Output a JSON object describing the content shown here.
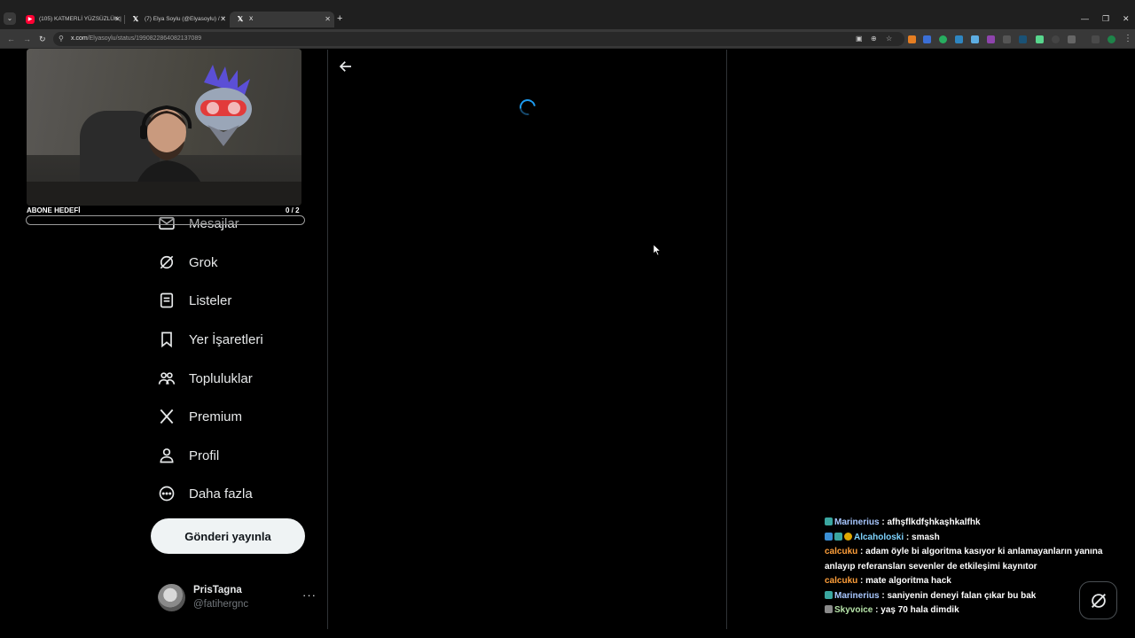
{
  "browser": {
    "tabs": [
      {
        "title": "(105) KATMERLİ YÜZSÜZLÜK |",
        "icon": "youtube-icon"
      },
      {
        "title": "(7) Elya Soylu (@Elyasoylu) / X",
        "icon": "x-logo-icon"
      },
      {
        "title": "X",
        "icon": "x-logo-icon"
      }
    ],
    "url_host": "x.com",
    "url_path": "/Elyasoylu/status/1990822864082137089"
  },
  "sidebar": {
    "items": [
      {
        "label": "Mesajlar",
        "icon": "mail-icon"
      },
      {
        "label": "Grok",
        "icon": "grok-icon"
      },
      {
        "label": "Listeler",
        "icon": "list-icon"
      },
      {
        "label": "Yer İşaretleri",
        "icon": "bookmark-icon"
      },
      {
        "label": "Topluluklar",
        "icon": "communities-icon"
      },
      {
        "label": "Premium",
        "icon": "x-logo-icon"
      },
      {
        "label": "Profil",
        "icon": "person-icon"
      },
      {
        "label": "Daha fazla",
        "icon": "more-circle-icon"
      }
    ],
    "post_button": "Gönderi yayınla",
    "profile": {
      "name": "PrisTagna",
      "handle": "@fatihergnc",
      "more": "···"
    }
  },
  "stream": {
    "sub_goal_label": "ABONE HEDEFİ",
    "sub_goal_count": "0  / 2",
    "sub_goal_progress": 0
  },
  "chat": {
    "messages": [
      {
        "user": "Marinerius",
        "color": "#a8c7ff",
        "text": "afhşflkdfşhkaşhkalfhk"
      },
      {
        "user": "Alcaholoski",
        "color": "#7fd4ff",
        "text": "smash"
      },
      {
        "user": "calcuku",
        "color": "#ff9f3a",
        "text": "adam öyle bi algoritma kasıyor ki anlamayanların yanına anlayıp referansları sevenler de etkileşimi kaynıtor"
      },
      {
        "user": "calcuku",
        "color": "#ff9f3a",
        "text": "mate algoritma hack"
      },
      {
        "user": "Marinerius",
        "color": "#a8c7ff",
        "text": "saniyenin deneyi falan çıkar bu bak"
      },
      {
        "user": "Skyvoice",
        "color": "#b6e3a8",
        "text": "yaş 70 hala dimdik"
      }
    ]
  },
  "colors": {
    "accent": "#1d9bf0",
    "border": "#2f3336",
    "muted": "#71767b"
  }
}
